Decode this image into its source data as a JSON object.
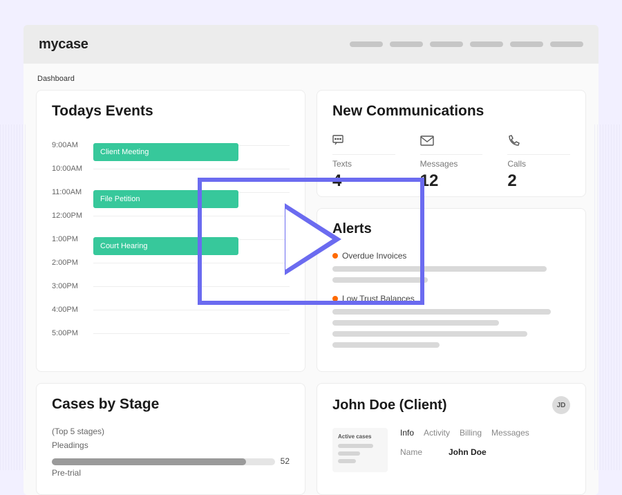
{
  "brand": {
    "name": "mycase"
  },
  "breadcrumb": "Dashboard",
  "todays_events": {
    "title": "Todays Events",
    "hours": [
      "9:00AM",
      "10:00AM",
      "11:00AM",
      "12:00PM",
      "1:00PM",
      "2:00PM",
      "3:00PM",
      "4:00PM",
      "5:00PM"
    ],
    "events": [
      {
        "time_index": 0,
        "label": "Client Meeting"
      },
      {
        "time_index": 2,
        "label": "File Petition"
      },
      {
        "time_index": 4,
        "label": "Court Hearing"
      }
    ]
  },
  "communications": {
    "title": "New Communications",
    "items": [
      {
        "label": "Texts",
        "value": "4",
        "icon": "chat-icon"
      },
      {
        "label": "Messages",
        "value": "12",
        "icon": "mail-icon"
      },
      {
        "label": "Calls",
        "value": "2",
        "icon": "phone-icon"
      }
    ]
  },
  "alerts": {
    "title": "Alerts",
    "items": [
      {
        "label": "Overdue Invoices"
      },
      {
        "label": "Low Trust Balances"
      }
    ]
  },
  "cases": {
    "title": "Cases by Stage",
    "subtitle": "(Top 5 stages)",
    "stages": [
      {
        "label": "Pleadings",
        "value": 52,
        "max": 60
      },
      {
        "label": "Pre-trial",
        "value": null,
        "max": 60
      }
    ]
  },
  "client": {
    "title": "John Doe (Client)",
    "initials": "JD",
    "side_title": "Active cases",
    "tabs": [
      "Info",
      "Activity",
      "Billing",
      "Messages"
    ],
    "active_tab": "Info",
    "fields": [
      {
        "label": "Name",
        "value": "John Doe"
      }
    ]
  }
}
